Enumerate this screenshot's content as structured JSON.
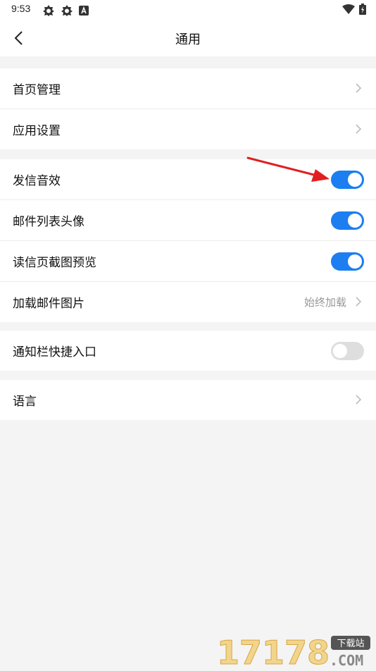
{
  "status_bar": {
    "time": "9:53",
    "left_icons": [
      "settings-icon",
      "settings-icon",
      "a-icon"
    ],
    "right_icons": [
      "wifi-icon",
      "battery-icon"
    ]
  },
  "header": {
    "title": "通用",
    "back_icon": "chevron-left-icon"
  },
  "groups": [
    {
      "rows": [
        {
          "label": "首页管理",
          "type": "link"
        },
        {
          "label": "应用设置",
          "type": "link"
        }
      ]
    },
    {
      "rows": [
        {
          "label": "发信音效",
          "type": "toggle",
          "on": true
        },
        {
          "label": "邮件列表头像",
          "type": "toggle",
          "on": true
        },
        {
          "label": "读信页截图预览",
          "type": "toggle",
          "on": true
        },
        {
          "label": "加载邮件图片",
          "type": "link",
          "value": "始终加载"
        }
      ]
    },
    {
      "rows": [
        {
          "label": "通知栏快捷入口",
          "type": "toggle",
          "on": false
        }
      ]
    },
    {
      "rows": [
        {
          "label": "语言",
          "type": "link"
        }
      ]
    }
  ],
  "annotation": {
    "arrow_icon": "red-arrow-icon"
  },
  "watermark": {
    "number": "17178",
    "tag": "下载站",
    "domain": ".COM"
  },
  "colors": {
    "accent": "#1c7ef0",
    "toggle_off": "#dedede",
    "background": "#f4f4f5",
    "arrow": "#e02020"
  }
}
